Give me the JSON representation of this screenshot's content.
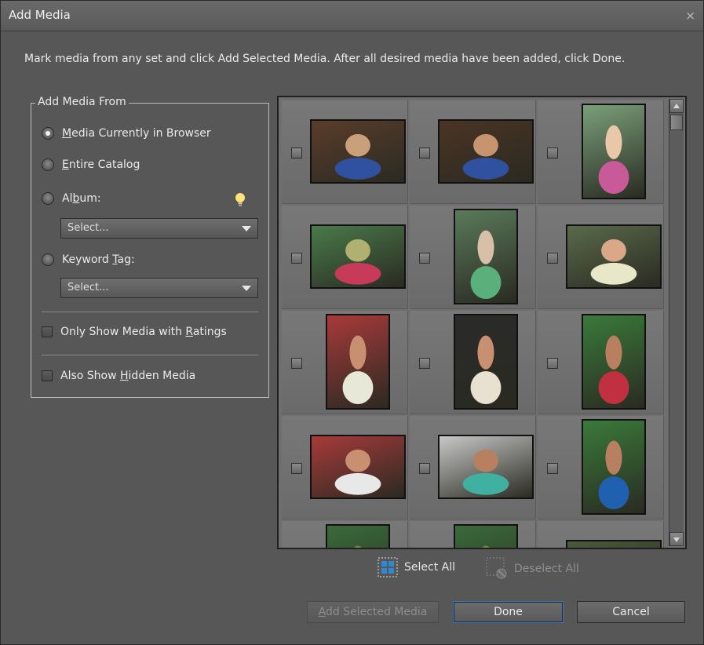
{
  "dialog": {
    "title": "Add Media",
    "close_glyph": "×",
    "instructions": "Mark media from any set and click Add Selected Media. After all desired media have been added, click Done."
  },
  "source_group": {
    "legend": "Add Media From",
    "options": [
      {
        "pre": "",
        "u": "M",
        "post": "edia Currently in Browser",
        "selected": true
      },
      {
        "pre": "",
        "u": "E",
        "post": "ntire Catalog",
        "selected": false
      },
      {
        "pre": "Al",
        "u": "b",
        "post": "um:",
        "selected": false
      },
      {
        "pre": "Keyword ",
        "u": "T",
        "post": "ag:",
        "selected": false
      }
    ],
    "album_select": "Select...",
    "keyword_select": "Select...",
    "only_ratings": {
      "pre": "Only Show Media with ",
      "u": "R",
      "post": "atings",
      "checked": false
    },
    "show_hidden": {
      "pre": "Also Show ",
      "u": "H",
      "post": "idden Media",
      "checked": false
    }
  },
  "media_grid": {
    "columns": 3,
    "items": [
      {
        "checked": false,
        "orientation": "landscape",
        "colors": [
          "#5a3d2b",
          "#caa07a",
          "#3050a0"
        ]
      },
      {
        "checked": false,
        "orientation": "landscape",
        "colors": [
          "#4a3424",
          "#c89470",
          "#3050a0"
        ]
      },
      {
        "checked": false,
        "orientation": "portrait",
        "colors": [
          "#7aa07a",
          "#e8c8a8",
          "#c85a9a"
        ]
      },
      {
        "checked": false,
        "orientation": "landscape",
        "colors": [
          "#4a7a4a",
          "#b0b070",
          "#c83a5a"
        ]
      },
      {
        "checked": false,
        "orientation": "portrait",
        "colors": [
          "#5a7a5a",
          "#d8c0a8",
          "#5ab07a"
        ]
      },
      {
        "checked": false,
        "orientation": "landscape",
        "colors": [
          "#5a6a4a",
          "#d8a888",
          "#e8e8c8"
        ]
      },
      {
        "checked": false,
        "orientation": "portrait",
        "colors": [
          "#a83a3a",
          "#c89070",
          "#e8e8d8"
        ]
      },
      {
        "checked": false,
        "orientation": "portrait",
        "colors": [
          "#2a2a2a",
          "#c89070",
          "#e8e0d0"
        ]
      },
      {
        "checked": false,
        "orientation": "portrait",
        "colors": [
          "#3a7a3a",
          "#b88060",
          "#c03040"
        ]
      },
      {
        "checked": false,
        "orientation": "landscape",
        "colors": [
          "#a83a3a",
          "#c89070",
          "#e8e8e8"
        ]
      },
      {
        "checked": false,
        "orientation": "landscape",
        "colors": [
          "#c8c8c8",
          "#b88060",
          "#40b0a0"
        ]
      },
      {
        "checked": false,
        "orientation": "portrait",
        "colors": [
          "#3a7a3a",
          "#b88060",
          "#2060b0"
        ]
      },
      {
        "checked": false,
        "orientation": "portrait",
        "colors": [
          "#3a6a3a",
          "#6a8a4a",
          "#3a5a2a"
        ]
      },
      {
        "checked": false,
        "orientation": "portrait",
        "colors": [
          "#3a6a3a",
          "#6a8a4a",
          "#3a5a2a"
        ]
      },
      {
        "checked": false,
        "orientation": "landscape",
        "colors": [
          "#4a5a3a",
          "#6a8a4a",
          "#3a5a2a"
        ]
      }
    ]
  },
  "selection": {
    "select_all": "Select All",
    "deselect_all": "Deselect All",
    "select_all_icon": "select-all-icon",
    "deselect_all_icon": "deselect-all-icon"
  },
  "buttons": {
    "add_selected": {
      "u": "A",
      "post": "dd Selected Media"
    },
    "done": "Done",
    "cancel": "Cancel"
  },
  "colors": {
    "dialog_bg": "#575757",
    "accent_blue": "#2d79c7",
    "bulb_yellow": "#ffe27a"
  }
}
